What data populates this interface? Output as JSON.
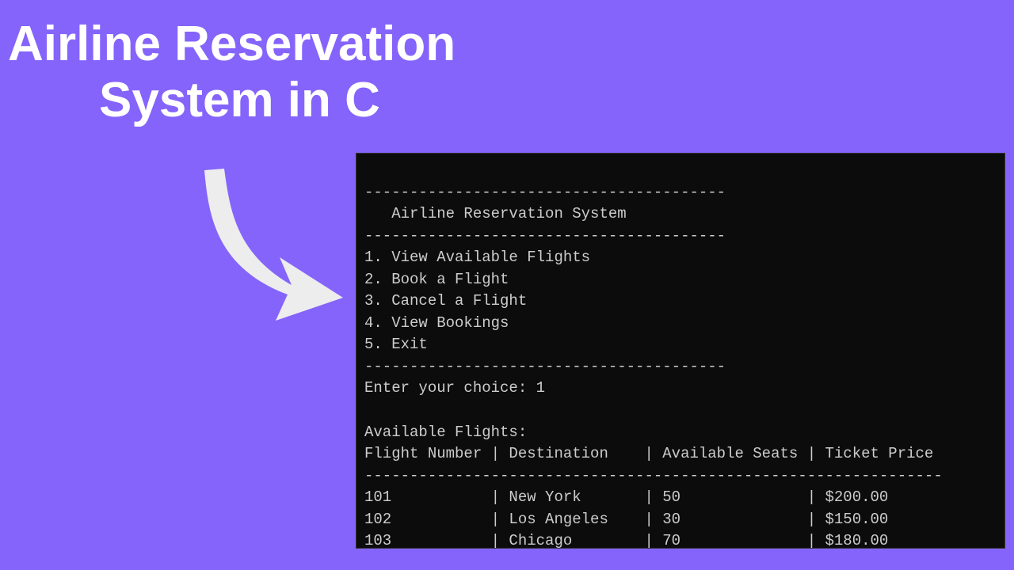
{
  "title": {
    "line1": "Airline Reservation",
    "line2": "System in C"
  },
  "terminal": {
    "header_rule": "----------------------------------------",
    "header_title": "   Airline Reservation System",
    "menu": [
      "1. View Available Flights",
      "2. Book a Flight",
      "3. Cancel a Flight",
      "4. View Bookings",
      "5. Exit"
    ],
    "prompt_label": "Enter your choice: ",
    "prompt_value": "1",
    "section_label": "Available Flights:",
    "table_header": "Flight Number | Destination    | Available Seats | Ticket Price",
    "table_rule": "----------------------------------------------------------------",
    "rows": [
      {
        "flight": "101",
        "dest": "New York",
        "seats": "50",
        "price": "$200.00"
      },
      {
        "flight": "102",
        "dest": "Los Angeles",
        "seats": "30",
        "price": "$150.00"
      },
      {
        "flight": "103",
        "dest": "Chicago",
        "seats": "70",
        "price": "$180.00"
      }
    ]
  }
}
